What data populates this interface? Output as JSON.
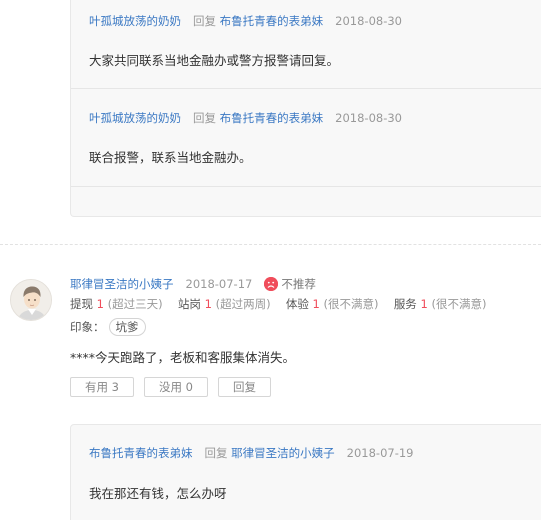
{
  "top_thread": {
    "replies": [
      {
        "user": "叶孤城放荡的奶奶",
        "reply_word": "回复",
        "target": "布鲁托青春的表弟妹",
        "date": "2018-08-30",
        "text": "大家共同联系当地金融办或警方报警请回复。"
      },
      {
        "user": "叶孤城放荡的奶奶",
        "reply_word": "回复",
        "target": "布鲁托青春的表弟妹",
        "date": "2018-08-30",
        "text": "联合报警，联系当地金融办。"
      }
    ]
  },
  "review": {
    "user": "耶律冒圣洁的小姨子",
    "date": "2018-07-17",
    "recommend_label": "不推荐",
    "recommend_icon": "sad-face-icon",
    "ratings": [
      {
        "label": "提现",
        "score": "1",
        "note": "(超过三天)"
      },
      {
        "label": "站岗",
        "score": "1",
        "note": "(超过两周)"
      },
      {
        "label": "体验",
        "score": "1",
        "note": "(很不满意)"
      },
      {
        "label": "服务",
        "score": "1",
        "note": "(很不满意)"
      }
    ],
    "impression_label": "印象：",
    "tags": [
      "坑爹"
    ],
    "content": "****今天跑路了，老板和客服集体消失。",
    "buttons": {
      "useful": "有用 3",
      "useless": "没用 0",
      "reply": "回复"
    },
    "reply": {
      "user": "布鲁托青春的表弟妹",
      "reply_word": "回复",
      "target": "耶律冒圣洁的小姨子",
      "date": "2018-07-19",
      "text": "我在那还有钱，怎么办呀"
    }
  },
  "colors": {
    "link": "#3a78c3",
    "score": "#f04d5b",
    "box_bg": "#f8f8f8"
  }
}
